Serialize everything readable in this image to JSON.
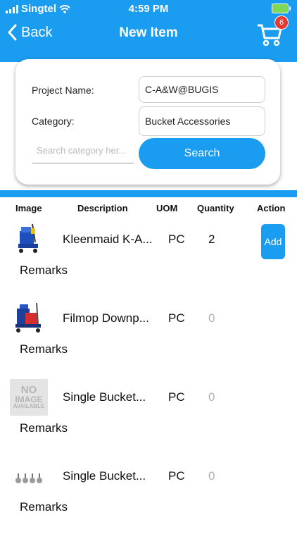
{
  "status_bar": {
    "carrier": "Singtel",
    "time": "4:59 PM"
  },
  "nav": {
    "back_label": "Back",
    "title": "New Item",
    "cart_count": "6"
  },
  "form": {
    "project_label": "Project Name:",
    "project_value": "C-A&W@BUGIS",
    "category_label": "Category:",
    "category_value": "Bucket Accessories",
    "search_placeholder": "Search category her...",
    "search_button": "Search"
  },
  "table": {
    "headers": [
      "Image",
      "Description",
      "UOM",
      "Quantity",
      "Action"
    ],
    "rows": [
      {
        "description": "Kleenmaid K-A...",
        "uom": "PC",
        "quantity": "2",
        "action": "Add",
        "remarks": "Remarks",
        "image": "trolley-blue"
      },
      {
        "description": "Filmop Downp...",
        "uom": "PC",
        "quantity": "0",
        "remarks": "Remarks",
        "image": "trolley-red"
      },
      {
        "description": "Single Bucket...",
        "uom": "PC",
        "quantity": "0",
        "remarks": "Remarks",
        "image": "no-image",
        "no_image_text": [
          "NO",
          "IMAGE",
          "AVAILABLE"
        ]
      },
      {
        "description": "Single Bucket...",
        "uom": "PC",
        "quantity": "0",
        "remarks": "Remarks",
        "image": "wheels"
      }
    ]
  },
  "colors": {
    "accent": "#1a9cf0",
    "badge": "#e53935"
  }
}
